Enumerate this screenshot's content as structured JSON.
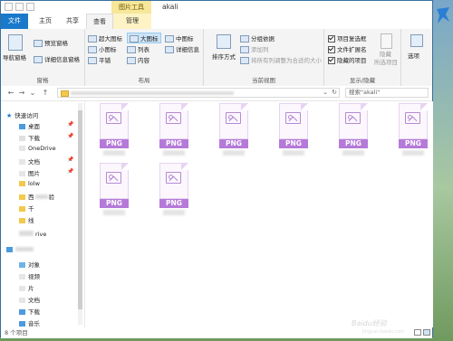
{
  "window": {
    "title": "akali",
    "context_tab_label": "图片工具"
  },
  "tabs": [
    {
      "label": "文件"
    },
    {
      "label": "主页"
    },
    {
      "label": "共享"
    },
    {
      "label": "查看"
    },
    {
      "label": "管理"
    }
  ],
  "ribbon": {
    "panes": {
      "label": "窗格",
      "nav_pane": "导航窗格",
      "preview_pane": "预览窗格",
      "details_pane": "详细信息窗格"
    },
    "layout": {
      "label": "布局",
      "items": [
        "超大图标",
        "大图标",
        "中图标",
        "小图标",
        "列表",
        "详细信息",
        "平铺",
        "内容"
      ],
      "selected": "大图标"
    },
    "current_view": {
      "label": "当前视图",
      "sort_by": "排序方式",
      "group_by": "分组依据",
      "add_columns": "添加列",
      "size_all_columns": "将所有列调整为合适的大小"
    },
    "show_hide": {
      "label": "显示/隐藏",
      "item_checkboxes": {
        "label": "项目复选框",
        "checked": true
      },
      "file_extensions": {
        "label": "文件扩展名",
        "checked": true
      },
      "hidden_items": {
        "label": "隐藏的项目",
        "checked": true
      },
      "hide_selected": "隐藏",
      "hide_selected_sub": "所选项目"
    },
    "options": "选项"
  },
  "search": {
    "placeholder": "搜索\"akali\""
  },
  "nav_pane": {
    "items": [
      {
        "label": "快速访问"
      },
      {
        "label": "桌面"
      },
      {
        "label": "下载"
      },
      {
        "label": "OneDrive"
      },
      {
        "label": "文档"
      },
      {
        "label": "图片"
      },
      {
        "label": "lolw"
      },
      {
        "label": "西"
      },
      {
        "label": "验"
      },
      {
        "label": "千"
      },
      {
        "label": "线"
      },
      {
        "label": "rive"
      },
      {
        "label": "对象"
      },
      {
        "label": "视频"
      },
      {
        "label": "片"
      },
      {
        "label": "文档"
      },
      {
        "label": "下载"
      },
      {
        "label": "音乐"
      }
    ]
  },
  "files": [
    {
      "ext": "PNG"
    },
    {
      "ext": "PNG"
    },
    {
      "ext": "PNG"
    },
    {
      "ext": "PNG"
    },
    {
      "ext": "PNG"
    },
    {
      "ext": "PNG"
    },
    {
      "ext": "PNG"
    },
    {
      "ext": "PNG"
    }
  ],
  "status": {
    "item_count": "8 个项目"
  },
  "watermark": {
    "main": "Baidu经验",
    "sub": "jingyan.baidu.com"
  }
}
